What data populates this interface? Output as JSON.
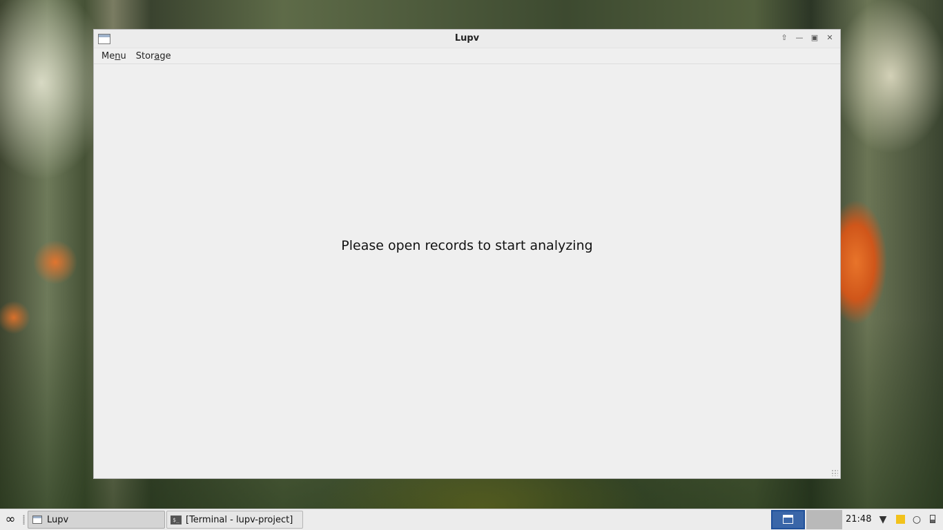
{
  "window": {
    "title": "Lupv",
    "menu": [
      {
        "label_pre": "Me",
        "label_underlined": "n",
        "label_post": "u"
      },
      {
        "label_pre": "Stor",
        "label_underlined": "a",
        "label_post": "ge"
      }
    ],
    "placeholder_message": "Please open records to start analyzing",
    "icons": {
      "shade": "arrow-up-icon",
      "minimize": "minimize-icon",
      "maximize": "maximize-icon",
      "close": "close-icon"
    }
  },
  "taskbar": {
    "tasks": [
      {
        "label": "Lupv",
        "active": true
      },
      {
        "label": "[Terminal - lupv-project]",
        "active": false
      }
    ],
    "clock": "21:48",
    "tray_icons": [
      "network-icon",
      "notes-icon",
      "lightbulb-icon",
      "battery-icon"
    ]
  }
}
